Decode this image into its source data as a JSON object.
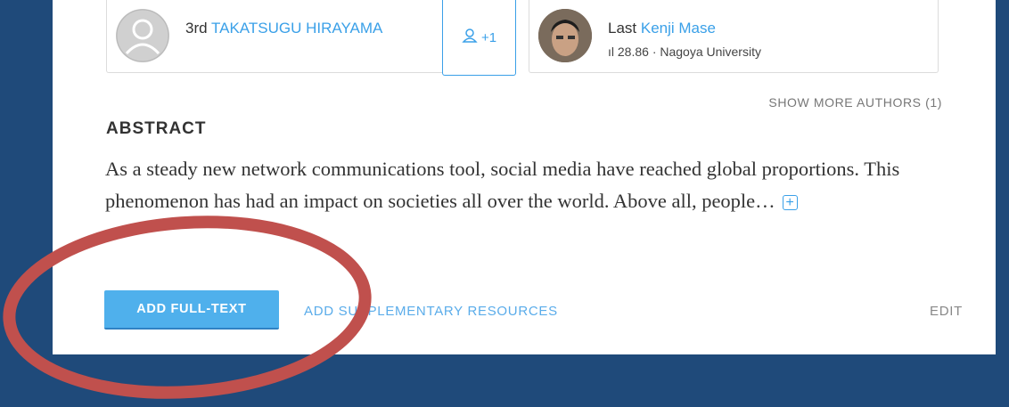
{
  "authors": [
    {
      "position": "3rd",
      "name": "TAKATSUGU HIRAYAMA",
      "meta": ""
    },
    {
      "position": "Last",
      "name": "Kenji Mase",
      "meta": "ıl 28.86 · Nagoya University"
    }
  ],
  "more_authors_button": {
    "label": "+1"
  },
  "show_more_authors": "SHOW MORE AUTHORS (1)",
  "abstract": {
    "heading": "ABSTRACT",
    "text": "As a steady new network communications tool, social media have reached global proportions. This phenomenon has had an impact on societies all over the world. Above all, people…",
    "expand_label": "+"
  },
  "actions": {
    "add_fulltext": "ADD FULL-TEXT",
    "add_supplementary": "ADD SUPPLEMENTARY RESOURCES",
    "edit": "EDIT"
  },
  "colors": {
    "background": "#1f4a7a",
    "accent": "#3aa0e8",
    "annotation_circle": "#c0504d"
  }
}
